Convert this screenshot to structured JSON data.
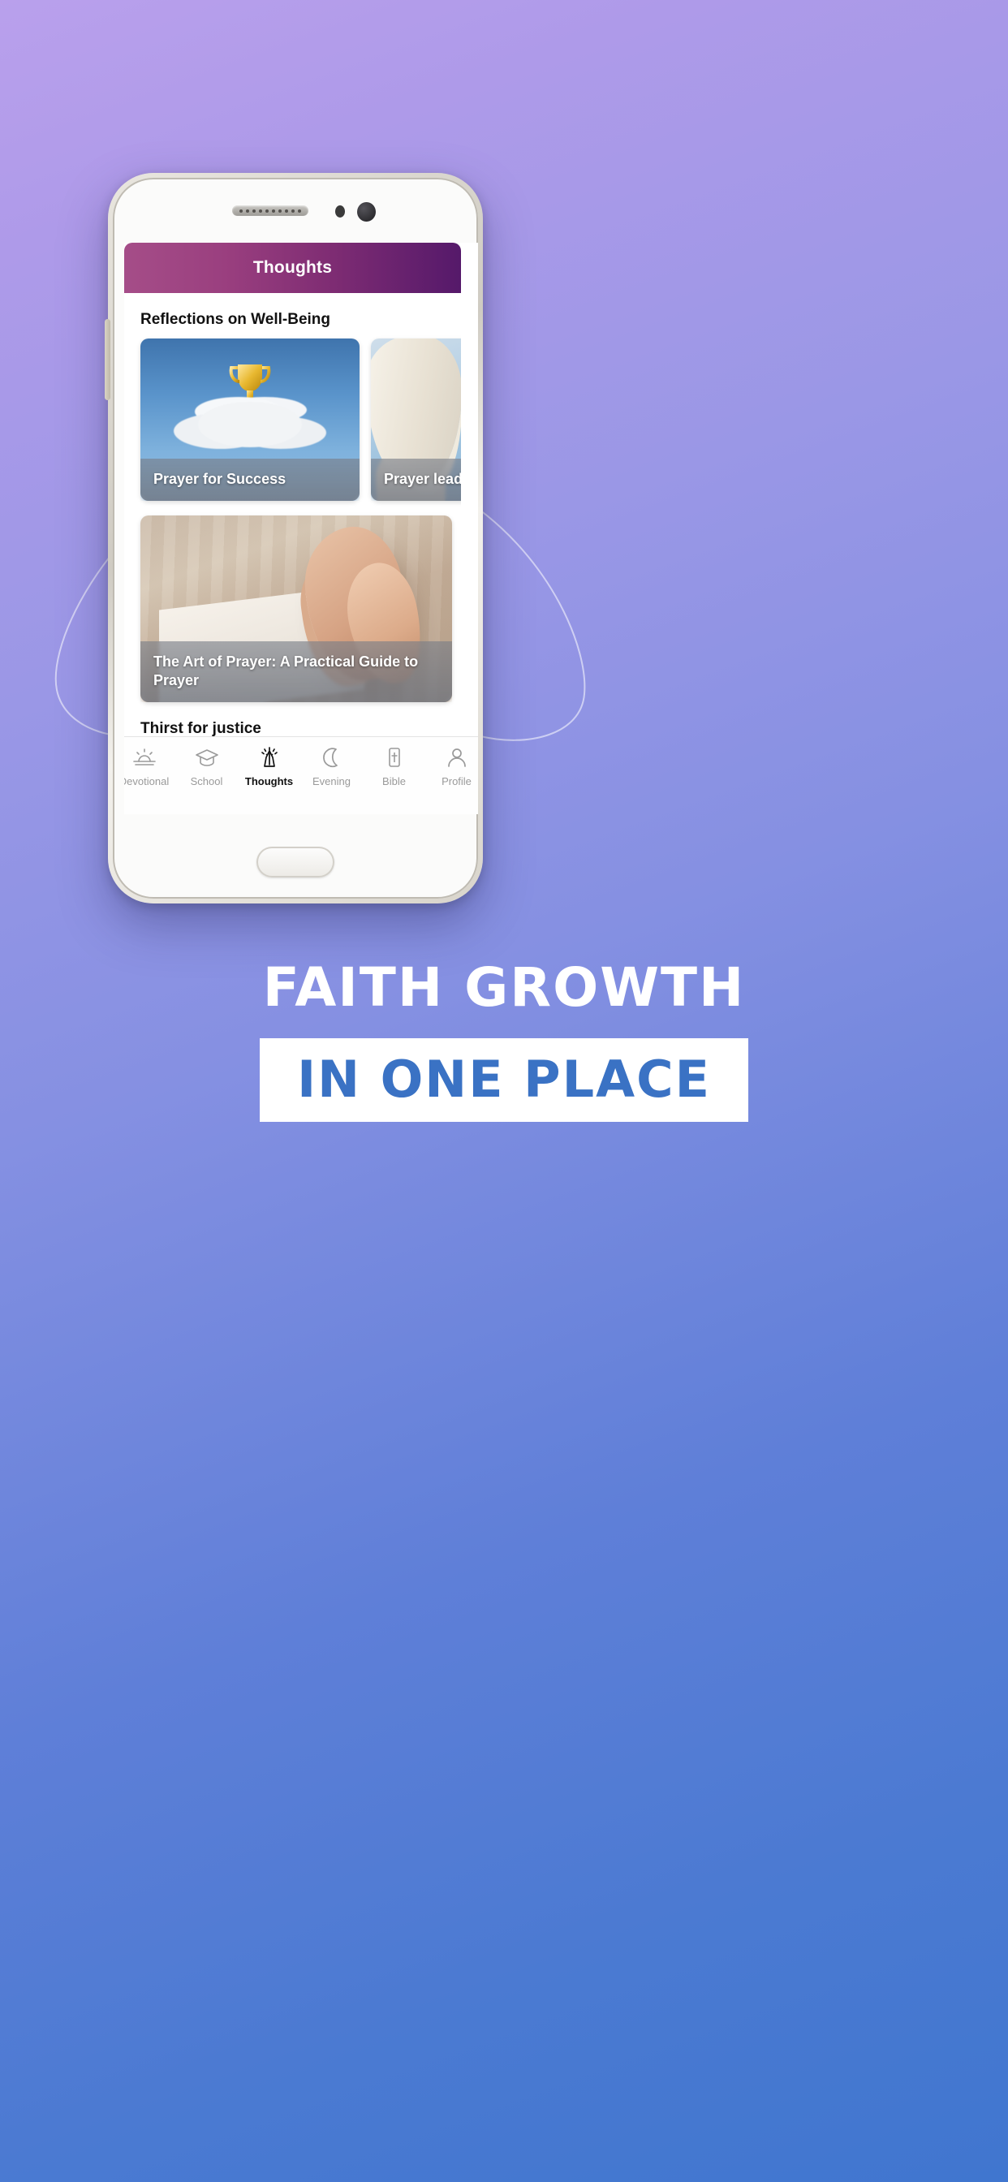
{
  "background": {
    "gradient_top": "#b9a0ec",
    "gradient_bottom": "#4076cf"
  },
  "phone": {
    "hardware": {
      "speaker_icon": "speaker-grille",
      "front_camera_icon": "front-camera",
      "sensor_icon": "proximity-sensor",
      "home_button_icon": "home-button"
    }
  },
  "app": {
    "header": {
      "title": "Thoughts",
      "accent_from": "#a54d88",
      "accent_to": "#55196a"
    },
    "sections": [
      {
        "title": "Reflections on Well-Being",
        "cards": [
          {
            "title": "Prayer for Success",
            "image": "trophy-on-cloud-blue-sky"
          },
          {
            "title": "Prayer leads to success and",
            "image": "cloud-pillar-with-bird"
          }
        ]
      },
      {
        "title": "",
        "cards": [
          {
            "title": "The Art of Prayer: A Practical Guide to Prayer",
            "image": "praying-hands-on-book"
          }
        ]
      },
      {
        "title": "Thirst for justice",
        "cards": [
          {
            "title": "",
            "image": "fiery-sky-storm"
          },
          {
            "title": "",
            "image": "grey-striped-texture"
          }
        ]
      }
    ],
    "nav": {
      "items": [
        {
          "label": "Devotional",
          "icon": "sunrise-icon",
          "active": false
        },
        {
          "label": "School",
          "icon": "graduation-cap-icon",
          "active": false
        },
        {
          "label": "Thoughts",
          "icon": "praying-hands-icon",
          "active": true
        },
        {
          "label": "Evening",
          "icon": "moon-icon",
          "active": false
        },
        {
          "label": "Bible",
          "icon": "bible-cross-icon",
          "active": false
        },
        {
          "label": "Profile",
          "icon": "person-icon",
          "active": false
        }
      ],
      "active_color": "#111111",
      "inactive_color": "#9a9a9a"
    }
  },
  "headline": {
    "line1": "FAITH GROWTH",
    "line2": "IN ONE PLACE",
    "line1_color": "#ffffff",
    "line2_color": "#3a72c4",
    "line2_background": "#ffffff"
  }
}
